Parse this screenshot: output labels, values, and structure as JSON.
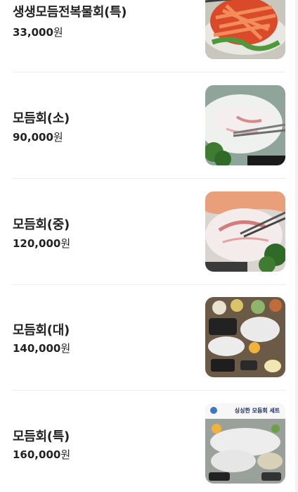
{
  "menu": {
    "price_unit": "원",
    "items": [
      {
        "name": "생생모듬전복물회(특)",
        "price": "33,000",
        "image_icon": "mulhoe-bowl-photo"
      },
      {
        "name": "모듬회(소)",
        "price": "90,000",
        "image_icon": "sliced-raw-fish-photo"
      },
      {
        "name": "모듬회(중)",
        "price": "120,000",
        "image_icon": "sliced-raw-fish-photo"
      },
      {
        "name": "모듬회(대)",
        "price": "140,000",
        "image_icon": "table-spread-photo"
      },
      {
        "name": "모듬회(특)",
        "price": "160,000",
        "image_icon": "set-banner-photo",
        "image_caption": "싱싱한 모듬회 세트"
      }
    ]
  }
}
